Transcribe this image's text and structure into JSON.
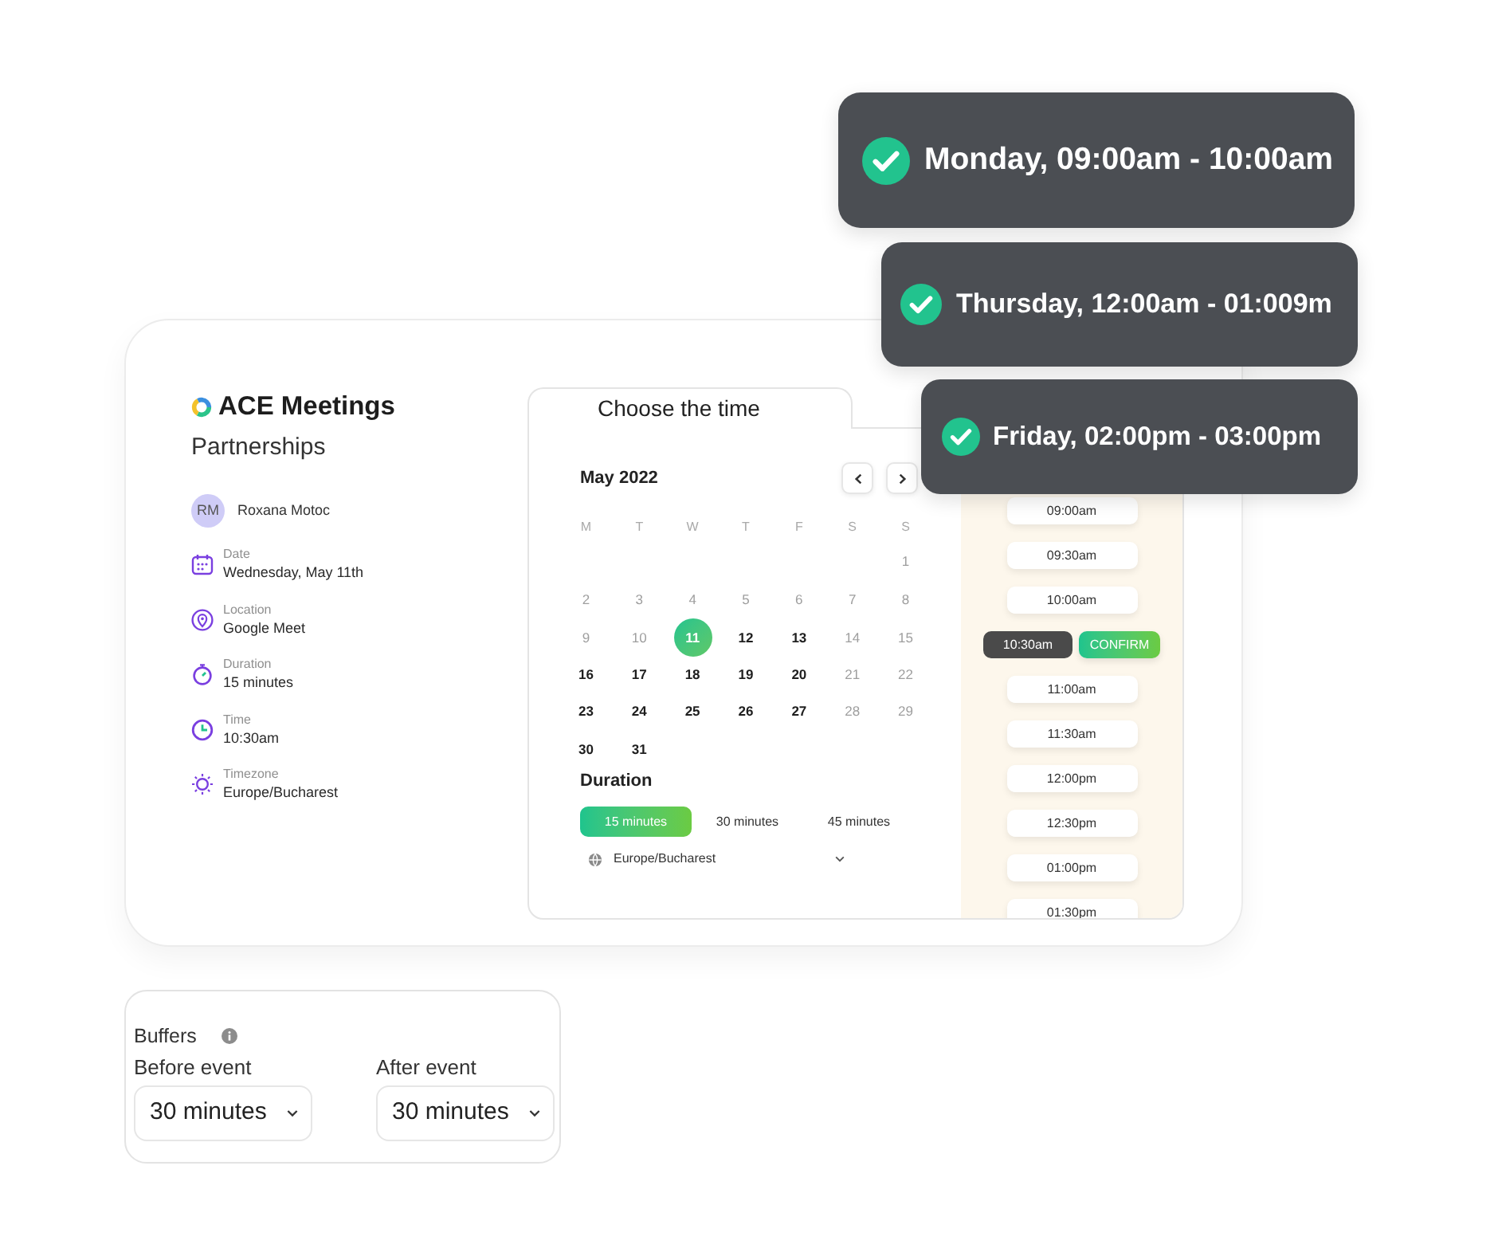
{
  "booking_card": {
    "brand": "ACE Meetings",
    "event_title": "Partnerships",
    "host": {
      "initials": "RM",
      "name": "Roxana Motoc"
    },
    "details": [
      {
        "kind": "date",
        "label": "Date",
        "value": "Wednesday, May 11th"
      },
      {
        "kind": "location",
        "label": "Location",
        "value": "Google Meet"
      },
      {
        "kind": "duration",
        "label": "Duration",
        "value": "15 minutes"
      },
      {
        "kind": "time",
        "label": "Time",
        "value": "10:30am"
      },
      {
        "kind": "timezone",
        "label": "Timezone",
        "value": "Europe/Bucharest"
      }
    ]
  },
  "scheduler": {
    "tab_title": "Choose the time",
    "month": "May 2022",
    "weekdays": [
      "M",
      "T",
      "W",
      "T",
      "F",
      "S",
      "S"
    ],
    "weeks": [
      [
        {
          "label": "1",
          "disabled": true,
          "selected": false
        }
      ],
      [
        {
          "label": "2",
          "disabled": true,
          "selected": false
        },
        {
          "label": "3",
          "disabled": true,
          "selected": false
        },
        {
          "label": "4",
          "disabled": true,
          "selected": false
        },
        {
          "label": "5",
          "disabled": true,
          "selected": false
        },
        {
          "label": "6",
          "disabled": true,
          "selected": false
        },
        {
          "label": "7",
          "disabled": true,
          "selected": false
        },
        {
          "label": "8",
          "disabled": true,
          "selected": false
        }
      ],
      [
        {
          "label": "9",
          "disabled": true,
          "selected": false
        },
        {
          "label": "10",
          "disabled": true,
          "selected": false
        },
        {
          "label": "11",
          "disabled": false,
          "selected": true
        },
        {
          "label": "12",
          "disabled": false,
          "selected": false
        },
        {
          "label": "13",
          "disabled": false,
          "selected": false
        },
        {
          "label": "14",
          "disabled": true,
          "selected": false
        },
        {
          "label": "15",
          "disabled": true,
          "selected": false
        }
      ],
      [
        {
          "label": "16",
          "disabled": false,
          "selected": false
        },
        {
          "label": "17",
          "disabled": false,
          "selected": false
        },
        {
          "label": "18",
          "disabled": false,
          "selected": false
        },
        {
          "label": "19",
          "disabled": false,
          "selected": false
        },
        {
          "label": "20",
          "disabled": false,
          "selected": false
        },
        {
          "label": "21",
          "disabled": true,
          "selected": false
        },
        {
          "label": "22",
          "disabled": true,
          "selected": false
        }
      ],
      [
        {
          "label": "23",
          "disabled": false,
          "selected": false
        },
        {
          "label": "24",
          "disabled": false,
          "selected": false
        },
        {
          "label": "25",
          "disabled": false,
          "selected": false
        },
        {
          "label": "26",
          "disabled": false,
          "selected": false
        },
        {
          "label": "27",
          "disabled": false,
          "selected": false
        },
        {
          "label": "28",
          "disabled": true,
          "selected": false
        },
        {
          "label": "29",
          "disabled": true,
          "selected": false
        }
      ],
      [
        {
          "label": "30",
          "disabled": false,
          "selected": false
        },
        {
          "label": "31",
          "disabled": false,
          "selected": false
        }
      ]
    ],
    "duration_heading": "Duration",
    "durations": [
      {
        "label": "15 minutes",
        "selected": true
      },
      {
        "label": "30 minutes",
        "selected": false
      },
      {
        "label": "45 minutes",
        "selected": false
      }
    ],
    "timezone": "Europe/Bucharest",
    "time_slots": [
      {
        "label": "09:00am",
        "selected": false
      },
      {
        "label": "09:30am",
        "selected": false
      },
      {
        "label": "10:00am",
        "selected": false
      },
      {
        "label": "10:30am",
        "selected": true
      },
      {
        "label": "11:00am",
        "selected": false
      },
      {
        "label": "11:30am",
        "selected": false
      },
      {
        "label": "12:00pm",
        "selected": false
      },
      {
        "label": "12:30pm",
        "selected": false
      },
      {
        "label": "01:00pm",
        "selected": false
      },
      {
        "label": "01:30pm",
        "selected": false
      }
    ],
    "confirm_label": "CONFIRM"
  },
  "notifications": [
    {
      "text": "Monday, 09:00am - 10:00am"
    },
    {
      "text": "Thursday, 12:00am - 01:009m"
    },
    {
      "text": "Friday, 02:00pm - 03:00pm"
    }
  ],
  "buffers": {
    "title": "Buffers",
    "fields": [
      {
        "label": "Before event",
        "value": "30 minutes"
      },
      {
        "label": "After event",
        "value": "30 minutes"
      }
    ]
  }
}
